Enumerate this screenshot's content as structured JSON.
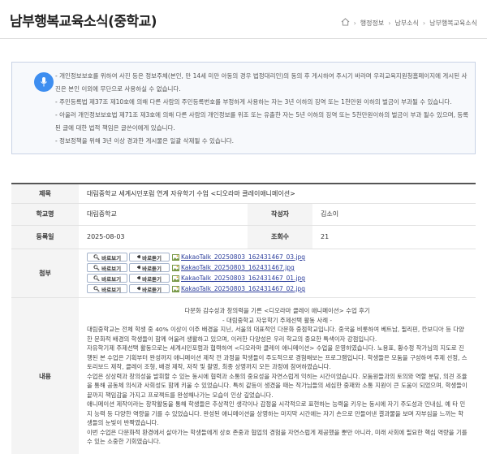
{
  "header": {
    "title": "남부행복교육소식(중학교)",
    "breadcrumb": [
      "행정정보",
      "남부소식",
      "남부행복교육소식"
    ]
  },
  "notice": {
    "items": [
      "- 개인정보보호를 위하여 사진 등은 정보주체(본인, 만 14세 미만 아동의 경우 법정대리인)의 동의 후 게시하여 주시기 바라며 우리교육지원청홈페이지에 게시된 사진은 본인 이외에 무단으로 사용하실 수 없습니다.",
      "- 주민등록법 제37조 제10호에 의해 다른 사람의 주민등록번호를 부정하게 사용하는 자는 3년 이하의 징역 또는 1천만원 이하의 벌금이 부과될 수 있습니다.",
      "- 아울러 개인정보보호법 제71조 제3호에 의해 다른 사람의 개인정보를 위조 또는 유출한 자는 5년 이하의 징역 또는 5천만원이하의 벌금이 부과 될수 있으며, 등록된 글에 대한 법적 책임은 글쓴이에게 있습니다.",
      "- 정보정책을 위해 3년 이상 경과한 게시물은 일괄 삭제될 수 있습니다."
    ]
  },
  "post": {
    "labels": {
      "title": "제목",
      "school": "학교명",
      "author": "작성자",
      "date": "등록일",
      "views": "조회수",
      "attachment": "첨부",
      "content": "내용"
    },
    "title": "대림중학교 세계시민포럼 연계 자유학기 수업 <디오라마 클레이애니메이션>",
    "school": "대림중학교",
    "author": "김소이",
    "date": "2025-08-03",
    "views": "21",
    "view_label": "바로보기",
    "listen_label": "바로듣기",
    "attachments": [
      "KakaoTalk_20250803_162431467_03.jpg",
      "KakaoTalk_20250803_162431467.jpg",
      "KakaoTalk_20250803_162431467_01.jpg",
      "KakaoTalk_20250803_162431467_02.jpg"
    ],
    "content": {
      "heading1": "다문화 감수성과 창의력을 기른 <디오라마 클레이 애니메이션> 수업 후기",
      "heading2": "- 대림중학교 자유학기 주제선택 활동 사례 -",
      "paragraphs": [
        "대림중학교는 전체 학생 중 40% 이상이 이주 배경을 지닌, 서울의 대표적인 다문화 중점학교입니다. 중국을 비롯하여 베트남, 필리핀, 칸보디아 등 다양한 문화적 배경의 학생들이 함께 어울려 생활하고 있으며, 이러한 다양성은 우리 학교의 중요한 특색이자 강점입니다.",
        "자유학기제 주제선택 활동으로는 세계시민포럼과 협력하여 <디오라마 클레이 애니메이션> 수업을 운영하였습니다. 노용표, 황수정 작가님의 지도로 진행된 본 수업은 기획부터 완성까지 애니메이션 제작 전 과정을 학생들이 주도적으로 경험해보는 프로그램입니다. 학생들은 모둠을 구성하여 주제 선정, 스토리보드 제작, 클레이 조형, 배경 제작, 저작 및 촬영, 최종 상영까지 모든 과정에 참여하였습니다.",
        "수업은 상상력과 창의성을 발휘할 수 있는 동시에 협력과 소통의 중요성을 자연스럽게 익히는 시간이었습니다. 모둠원들과의 토의와 역할 분담, 의견 조율을 통해 공동체 의식과 사회성도 함께 키울 수 있었습니다. 특히 같등이 생겼을 때는 작가님들의 세심한 중재와 소통 지원이 큰 도움이 되었으며, 학생들이 끝까지 책임감을 가지고 프로젝트를 완성해나가는 모습이 인상 깊었습니다.",
        "애니메이션 제작이라는 창작활동을 통해 학생들은 추상적인 생각이나 감정을 시각적으로 표현하는 능력을 키우는 동시에 자기 주도성과 인내심, 예 타 인지 능력 등 다양한 역량을 기를 수 있었습니다. 완성된 애니메이션을 상영하는 마지막 시간에는 자기 손으로 만들어낸 결과물을 보며 자부심을 느끼는 학생들의 눈빛이 반짝였습니다.",
        "이번 수업은 다문화적 환경에서 살아가는 학생들에게 상호 존중과 협업의 경험을 자연스럽게 제공했을 뿐만 아니라, 미래 사회에 필요한 핵심 역량을 기를 수 있는 소중한 기회였습니다."
      ]
    }
  },
  "colors": {
    "accent": "#3e8ef0",
    "link": "#2c3e9c",
    "table_header_bg": "#f4f4f4"
  }
}
